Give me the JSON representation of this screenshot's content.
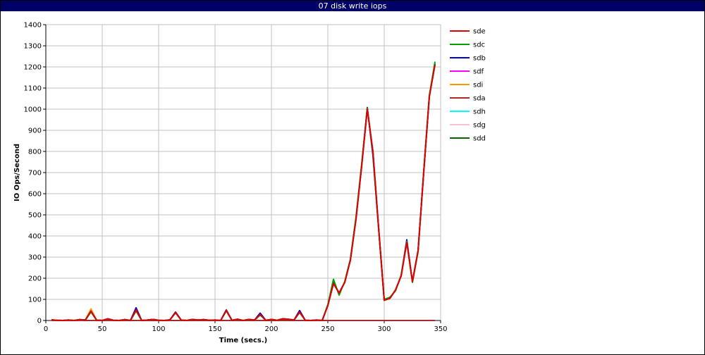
{
  "chart_data": {
    "type": "line",
    "title": "07 disk write iops",
    "xlabel": "Time (secs.)",
    "ylabel": "IO Ops/Second",
    "xlim": [
      0,
      350
    ],
    "ylim": [
      0,
      1400
    ],
    "xticks": [
      0,
      50,
      100,
      150,
      200,
      250,
      300,
      350
    ],
    "yticks": [
      0,
      100,
      200,
      300,
      400,
      500,
      600,
      700,
      800,
      900,
      1000,
      1100,
      1200,
      1300,
      1400
    ],
    "grid": true,
    "legend_position": "right",
    "x": [
      5,
      10,
      15,
      20,
      25,
      30,
      35,
      40,
      45,
      50,
      55,
      60,
      65,
      70,
      75,
      80,
      85,
      90,
      95,
      100,
      105,
      110,
      115,
      120,
      125,
      130,
      135,
      140,
      145,
      150,
      155,
      160,
      165,
      170,
      175,
      180,
      185,
      190,
      195,
      200,
      205,
      210,
      215,
      220,
      225,
      230,
      235,
      240,
      245,
      250,
      255,
      260,
      265,
      270,
      275,
      280,
      285,
      290,
      295,
      300,
      305,
      310,
      315,
      320,
      325,
      330,
      335,
      340,
      345
    ],
    "series": [
      {
        "name": "sde",
        "color": "#e00000",
        "values": [
          3,
          1,
          0,
          2,
          0,
          4,
          2,
          45,
          2,
          0,
          8,
          1,
          0,
          4,
          0,
          50,
          0,
          2,
          5,
          1,
          0,
          3,
          38,
          2,
          0,
          5,
          2,
          4,
          1,
          2,
          0,
          48,
          1,
          6,
          0,
          5,
          2,
          28,
          1,
          5,
          1,
          8,
          6,
          2,
          40,
          1,
          0,
          2,
          0,
          70,
          175,
          130,
          180,
          285,
          480,
          730,
          1000,
          800,
          440,
          95,
          105,
          145,
          210,
          370,
          185,
          330,
          700,
          1060,
          1210
        ]
      },
      {
        "name": "sdc",
        "color": "#00a000",
        "values": [
          3,
          1,
          0,
          2,
          0,
          4,
          2,
          40,
          2,
          0,
          7,
          1,
          0,
          4,
          0,
          45,
          0,
          2,
          5,
          1,
          0,
          3,
          36,
          2,
          0,
          5,
          2,
          4,
          1,
          2,
          0,
          45,
          1,
          6,
          0,
          5,
          2,
          26,
          1,
          5,
          1,
          8,
          6,
          2,
          38,
          1,
          0,
          2,
          0,
          75,
          195,
          120,
          185,
          290,
          490,
          740,
          1005,
          790,
          435,
          100,
          110,
          140,
          215,
          375,
          180,
          325,
          705,
          1065,
          1225
        ]
      },
      {
        "name": "sdb",
        "color": "#0000cc",
        "values": [
          3,
          1,
          0,
          2,
          0,
          4,
          2,
          42,
          2,
          0,
          8,
          1,
          0,
          4,
          0,
          60,
          0,
          2,
          5,
          1,
          0,
          3,
          40,
          2,
          0,
          5,
          2,
          4,
          1,
          2,
          0,
          50,
          1,
          6,
          0,
          5,
          2,
          35,
          1,
          5,
          1,
          8,
          6,
          2,
          47,
          1,
          0,
          2,
          0,
          72,
          180,
          128,
          182,
          288,
          485,
          735,
          1008,
          780,
          438,
          97,
          106,
          142,
          212,
          382,
          182,
          328,
          702,
          1062,
          1215
        ]
      },
      {
        "name": "sdf",
        "color": "#ff00ff",
        "values": [
          2,
          1,
          0,
          2,
          0,
          3,
          2,
          43,
          2,
          0,
          7,
          1,
          0,
          4,
          0,
          48,
          0,
          2,
          5,
          1,
          0,
          3,
          37,
          2,
          0,
          5,
          2,
          4,
          1,
          2,
          0,
          47,
          1,
          6,
          0,
          5,
          2,
          27,
          1,
          5,
          1,
          8,
          6,
          2,
          39,
          1,
          0,
          2,
          0,
          71,
          176,
          131,
          181,
          286,
          482,
          732,
          1001,
          798,
          441,
          96,
          104,
          144,
          211,
          371,
          184,
          331,
          701,
          1061,
          1211
        ]
      },
      {
        "name": "sdi",
        "color": "#ff9900",
        "values": [
          2,
          1,
          0,
          2,
          0,
          3,
          2,
          55,
          2,
          0,
          7,
          1,
          0,
          4,
          0,
          46,
          0,
          2,
          5,
          1,
          0,
          3,
          37,
          2,
          0,
          5,
          2,
          4,
          1,
          2,
          0,
          47,
          1,
          6,
          0,
          5,
          2,
          27,
          1,
          5,
          1,
          8,
          6,
          2,
          39,
          1,
          0,
          2,
          0,
          71,
          176,
          131,
          181,
          286,
          482,
          732,
          1001,
          798,
          441,
          96,
          104,
          144,
          211,
          371,
          184,
          331,
          701,
          1061,
          1211
        ]
      },
      {
        "name": "sda",
        "color": "#a52a2a",
        "values": [
          0,
          0,
          0,
          0,
          0,
          0,
          0,
          0,
          0,
          0,
          0,
          0,
          0,
          0,
          0,
          0,
          0,
          0,
          0,
          0,
          0,
          0,
          0,
          0,
          0,
          0,
          0,
          0,
          0,
          0,
          0,
          0,
          0,
          0,
          0,
          0,
          0,
          0,
          0,
          0,
          0,
          0,
          0,
          0,
          0,
          0,
          0,
          0,
          0,
          0,
          0,
          0,
          0,
          0,
          0,
          0,
          0,
          0,
          0,
          0,
          0,
          0,
          0,
          0,
          0,
          0,
          0,
          0,
          0
        ]
      },
      {
        "name": "sdh",
        "color": "#00ffff",
        "values": [
          0,
          0,
          0,
          0,
          0,
          0,
          0,
          0,
          0,
          0,
          0,
          0,
          0,
          0,
          0,
          0,
          0,
          0,
          0,
          0,
          0,
          0,
          0,
          0,
          0,
          0,
          0,
          0,
          0,
          0,
          0,
          0,
          0,
          0,
          0,
          0,
          0,
          0,
          0,
          0,
          0,
          0,
          0,
          0,
          0,
          0,
          0,
          0,
          0,
          0,
          0,
          0,
          0,
          0,
          0,
          0,
          0,
          0,
          0,
          0,
          0,
          0,
          0,
          0,
          0,
          0,
          0,
          0,
          0
        ]
      },
      {
        "name": "sdg",
        "color": "#ffc0cb",
        "values": [
          0,
          0,
          0,
          0,
          0,
          0,
          0,
          0,
          0,
          0,
          0,
          0,
          0,
          0,
          0,
          0,
          0,
          0,
          0,
          0,
          0,
          0,
          0,
          0,
          0,
          0,
          0,
          0,
          0,
          0,
          0,
          0,
          0,
          0,
          0,
          0,
          0,
          0,
          0,
          0,
          0,
          0,
          0,
          0,
          0,
          0,
          0,
          0,
          0,
          0,
          0,
          0,
          0,
          0,
          0,
          0,
          0,
          0,
          0,
          0,
          0,
          0,
          0,
          0,
          0,
          0,
          0,
          0,
          0
        ]
      },
      {
        "name": "sdd",
        "color": "#006400",
        "values": [
          0,
          0,
          0,
          0,
          0,
          0,
          0,
          0,
          0,
          0,
          0,
          0,
          0,
          0,
          0,
          0,
          0,
          0,
          0,
          0,
          0,
          0,
          0,
          0,
          0,
          0,
          0,
          0,
          0,
          0,
          0,
          0,
          0,
          0,
          0,
          0,
          0,
          0,
          0,
          0,
          0,
          0,
          0,
          0,
          0,
          0,
          0,
          0,
          0,
          0,
          0,
          0,
          0,
          0,
          0,
          0,
          0,
          0,
          0,
          0,
          0,
          0,
          0,
          0,
          0,
          0,
          0,
          0,
          0
        ]
      }
    ]
  }
}
